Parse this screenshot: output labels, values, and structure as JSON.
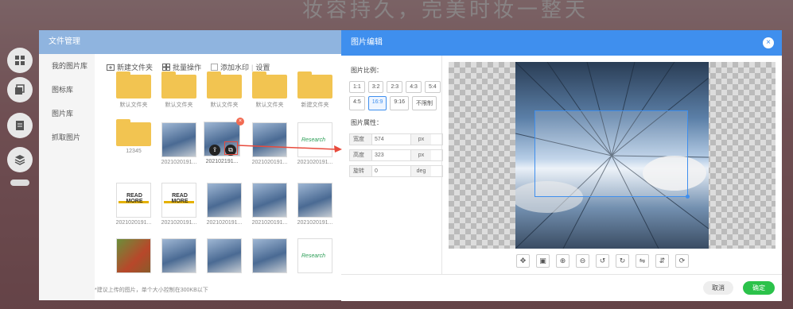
{
  "background_title": "妆容持久，完美时妆一整天",
  "side_icons": [
    "grid-icon",
    "layers-icon",
    "document-icon",
    "stack-icon"
  ],
  "file_manager": {
    "title": "文件管理",
    "sidebar": [
      {
        "label": "我的图片库",
        "active": true
      },
      {
        "label": "图标库",
        "active": false
      },
      {
        "label": "图片库",
        "active": false
      },
      {
        "label": "抓取图片",
        "active": false
      }
    ],
    "toolbar": {
      "new_folder": "新建文件夹",
      "batch": "批量操作",
      "watermark": "添加水印",
      "settings": "设置"
    },
    "tiles": [
      {
        "type": "folder",
        "label": "默认文件夹"
      },
      {
        "type": "folder",
        "label": "默认文件夹"
      },
      {
        "type": "folder",
        "label": "默认文件夹"
      },
      {
        "type": "folder",
        "label": "默认文件夹"
      },
      {
        "type": "folder",
        "label": "新建文件夹"
      },
      {
        "type": "folder",
        "label": "12345"
      },
      {
        "type": "photo",
        "label": "2021020191..."
      },
      {
        "type": "selected",
        "label": "202102191..."
      },
      {
        "type": "photo",
        "label": "2021020191..."
      },
      {
        "type": "research",
        "label": "2021020191..."
      },
      {
        "type": "readmore",
        "label": "2021020191..."
      },
      {
        "type": "readmore",
        "label": "2021020191..."
      },
      {
        "type": "photo",
        "label": "2021020191..."
      },
      {
        "type": "photo",
        "label": "2021020191..."
      },
      {
        "type": "photo",
        "label": "2021020191..."
      },
      {
        "type": "redpanda",
        "label": ""
      },
      {
        "type": "photo",
        "label": ""
      },
      {
        "type": "photo",
        "label": ""
      },
      {
        "type": "photo",
        "label": ""
      },
      {
        "type": "research",
        "label": ""
      }
    ],
    "footer": "*建议上传的图片，单个大小控制在300KB以下"
  },
  "editor": {
    "title": "图片编辑",
    "ratio_label": "图片比例：",
    "ratios": [
      {
        "label": "1:1",
        "on": false
      },
      {
        "label": "3:2",
        "on": false
      },
      {
        "label": "2:3",
        "on": false
      },
      {
        "label": "4:3",
        "on": false
      },
      {
        "label": "5:4",
        "on": false
      },
      {
        "label": "4:5",
        "on": false
      },
      {
        "label": "16:9",
        "on": true
      },
      {
        "label": "9:16",
        "on": false
      },
      {
        "label": "不限制",
        "on": false
      }
    ],
    "attr_label": "图片属性：",
    "width": {
      "label": "宽度",
      "value": "574",
      "unit": "px"
    },
    "height": {
      "label": "高度",
      "value": "323",
      "unit": "px"
    },
    "rotate": {
      "label": "旋转",
      "value": "0",
      "unit": "deg"
    },
    "tools": [
      "move-icon",
      "crop-icon",
      "zoom-in-icon",
      "zoom-out-icon",
      "rotate-left-icon",
      "rotate-right-icon",
      "flip-horizontal-icon",
      "flip-vertical-icon",
      "reset-icon"
    ],
    "cancel": "取消",
    "ok": "确定"
  },
  "colors": {
    "accent": "#3f8fee",
    "ok": "#2bc24a",
    "folder": "#f2c451"
  }
}
